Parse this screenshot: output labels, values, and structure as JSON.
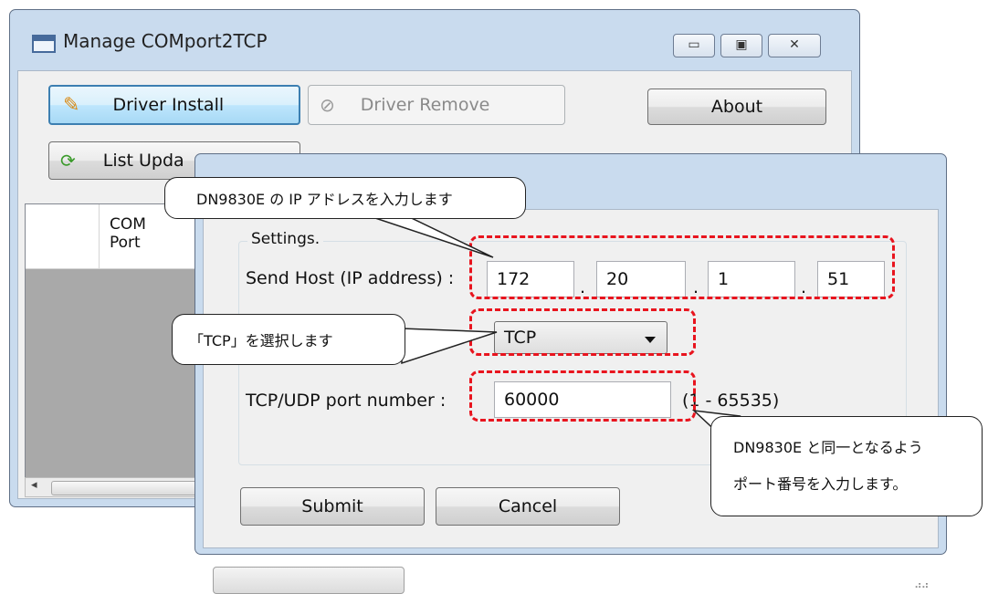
{
  "main_window": {
    "title": "Manage COMport2TCP",
    "minimize_icon": "minimize-icon",
    "maximize_icon": "maximize-icon",
    "close_icon": "close-icon",
    "buttons": {
      "driver_install": "Driver Install",
      "driver_remove": "Driver Remove",
      "about": "About",
      "list_update": "List Upda"
    },
    "list_header": {
      "com_port": "COM\nPort"
    }
  },
  "settings_dialog": {
    "group_label": "Settings.",
    "send_host_label": "Send Host (IP address) :",
    "ip": [
      "172",
      "20",
      "1",
      "51"
    ],
    "ip_separator": ".",
    "protocol": "TCP",
    "port_label": "TCP/UDP port number :",
    "port_value": "60000",
    "port_range": "(1 - 65535)",
    "submit": "Submit",
    "cancel": "Cancel"
  },
  "callouts": {
    "ip": "DN9830E の IP アドレスを入力します",
    "protocol": "「TCP」を選択します",
    "port_line1": "DN9830E と同一となるよう",
    "port_line2": "ポート番号を入力します。"
  },
  "colors": {
    "annotation_red": "#e8141e",
    "window_frame": "#c9dbee"
  }
}
